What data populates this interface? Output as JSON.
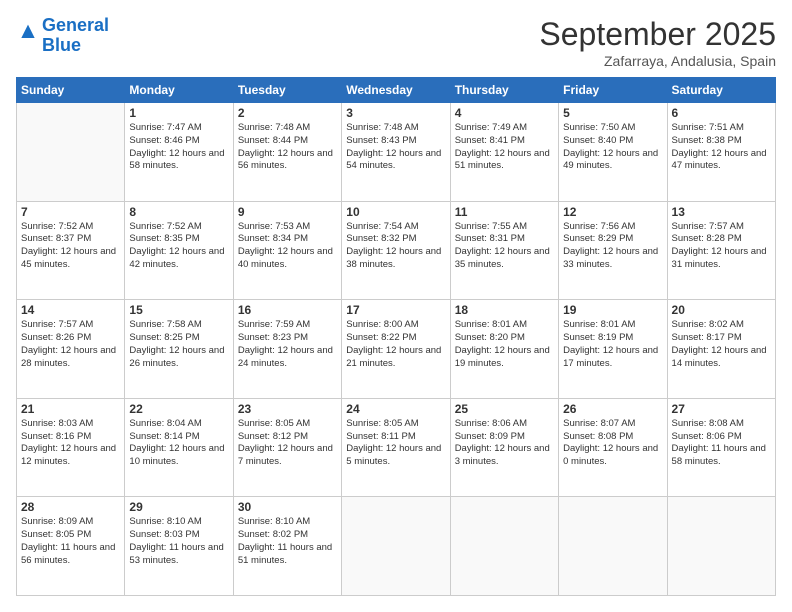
{
  "header": {
    "logo_line1": "General",
    "logo_line2": "Blue",
    "month": "September 2025",
    "location": "Zafarraya, Andalusia, Spain"
  },
  "weekdays": [
    "Sunday",
    "Monday",
    "Tuesday",
    "Wednesday",
    "Thursday",
    "Friday",
    "Saturday"
  ],
  "weeks": [
    [
      {
        "day": "",
        "content": ""
      },
      {
        "day": "1",
        "content": "Sunrise: 7:47 AM\nSunset: 8:46 PM\nDaylight: 12 hours\nand 58 minutes."
      },
      {
        "day": "2",
        "content": "Sunrise: 7:48 AM\nSunset: 8:44 PM\nDaylight: 12 hours\nand 56 minutes."
      },
      {
        "day": "3",
        "content": "Sunrise: 7:48 AM\nSunset: 8:43 PM\nDaylight: 12 hours\nand 54 minutes."
      },
      {
        "day": "4",
        "content": "Sunrise: 7:49 AM\nSunset: 8:41 PM\nDaylight: 12 hours\nand 51 minutes."
      },
      {
        "day": "5",
        "content": "Sunrise: 7:50 AM\nSunset: 8:40 PM\nDaylight: 12 hours\nand 49 minutes."
      },
      {
        "day": "6",
        "content": "Sunrise: 7:51 AM\nSunset: 8:38 PM\nDaylight: 12 hours\nand 47 minutes."
      }
    ],
    [
      {
        "day": "7",
        "content": "Sunrise: 7:52 AM\nSunset: 8:37 PM\nDaylight: 12 hours\nand 45 minutes."
      },
      {
        "day": "8",
        "content": "Sunrise: 7:52 AM\nSunset: 8:35 PM\nDaylight: 12 hours\nand 42 minutes."
      },
      {
        "day": "9",
        "content": "Sunrise: 7:53 AM\nSunset: 8:34 PM\nDaylight: 12 hours\nand 40 minutes."
      },
      {
        "day": "10",
        "content": "Sunrise: 7:54 AM\nSunset: 8:32 PM\nDaylight: 12 hours\nand 38 minutes."
      },
      {
        "day": "11",
        "content": "Sunrise: 7:55 AM\nSunset: 8:31 PM\nDaylight: 12 hours\nand 35 minutes."
      },
      {
        "day": "12",
        "content": "Sunrise: 7:56 AM\nSunset: 8:29 PM\nDaylight: 12 hours\nand 33 minutes."
      },
      {
        "day": "13",
        "content": "Sunrise: 7:57 AM\nSunset: 8:28 PM\nDaylight: 12 hours\nand 31 minutes."
      }
    ],
    [
      {
        "day": "14",
        "content": "Sunrise: 7:57 AM\nSunset: 8:26 PM\nDaylight: 12 hours\nand 28 minutes."
      },
      {
        "day": "15",
        "content": "Sunrise: 7:58 AM\nSunset: 8:25 PM\nDaylight: 12 hours\nand 26 minutes."
      },
      {
        "day": "16",
        "content": "Sunrise: 7:59 AM\nSunset: 8:23 PM\nDaylight: 12 hours\nand 24 minutes."
      },
      {
        "day": "17",
        "content": "Sunrise: 8:00 AM\nSunset: 8:22 PM\nDaylight: 12 hours\nand 21 minutes."
      },
      {
        "day": "18",
        "content": "Sunrise: 8:01 AM\nSunset: 8:20 PM\nDaylight: 12 hours\nand 19 minutes."
      },
      {
        "day": "19",
        "content": "Sunrise: 8:01 AM\nSunset: 8:19 PM\nDaylight: 12 hours\nand 17 minutes."
      },
      {
        "day": "20",
        "content": "Sunrise: 8:02 AM\nSunset: 8:17 PM\nDaylight: 12 hours\nand 14 minutes."
      }
    ],
    [
      {
        "day": "21",
        "content": "Sunrise: 8:03 AM\nSunset: 8:16 PM\nDaylight: 12 hours\nand 12 minutes."
      },
      {
        "day": "22",
        "content": "Sunrise: 8:04 AM\nSunset: 8:14 PM\nDaylight: 12 hours\nand 10 minutes."
      },
      {
        "day": "23",
        "content": "Sunrise: 8:05 AM\nSunset: 8:12 PM\nDaylight: 12 hours\nand 7 minutes."
      },
      {
        "day": "24",
        "content": "Sunrise: 8:05 AM\nSunset: 8:11 PM\nDaylight: 12 hours\nand 5 minutes."
      },
      {
        "day": "25",
        "content": "Sunrise: 8:06 AM\nSunset: 8:09 PM\nDaylight: 12 hours\nand 3 minutes."
      },
      {
        "day": "26",
        "content": "Sunrise: 8:07 AM\nSunset: 8:08 PM\nDaylight: 12 hours\nand 0 minutes."
      },
      {
        "day": "27",
        "content": "Sunrise: 8:08 AM\nSunset: 8:06 PM\nDaylight: 11 hours\nand 58 minutes."
      }
    ],
    [
      {
        "day": "28",
        "content": "Sunrise: 8:09 AM\nSunset: 8:05 PM\nDaylight: 11 hours\nand 56 minutes."
      },
      {
        "day": "29",
        "content": "Sunrise: 8:10 AM\nSunset: 8:03 PM\nDaylight: 11 hours\nand 53 minutes."
      },
      {
        "day": "30",
        "content": "Sunrise: 8:10 AM\nSunset: 8:02 PM\nDaylight: 11 hours\nand 51 minutes."
      },
      {
        "day": "",
        "content": ""
      },
      {
        "day": "",
        "content": ""
      },
      {
        "day": "",
        "content": ""
      },
      {
        "day": "",
        "content": ""
      }
    ]
  ]
}
